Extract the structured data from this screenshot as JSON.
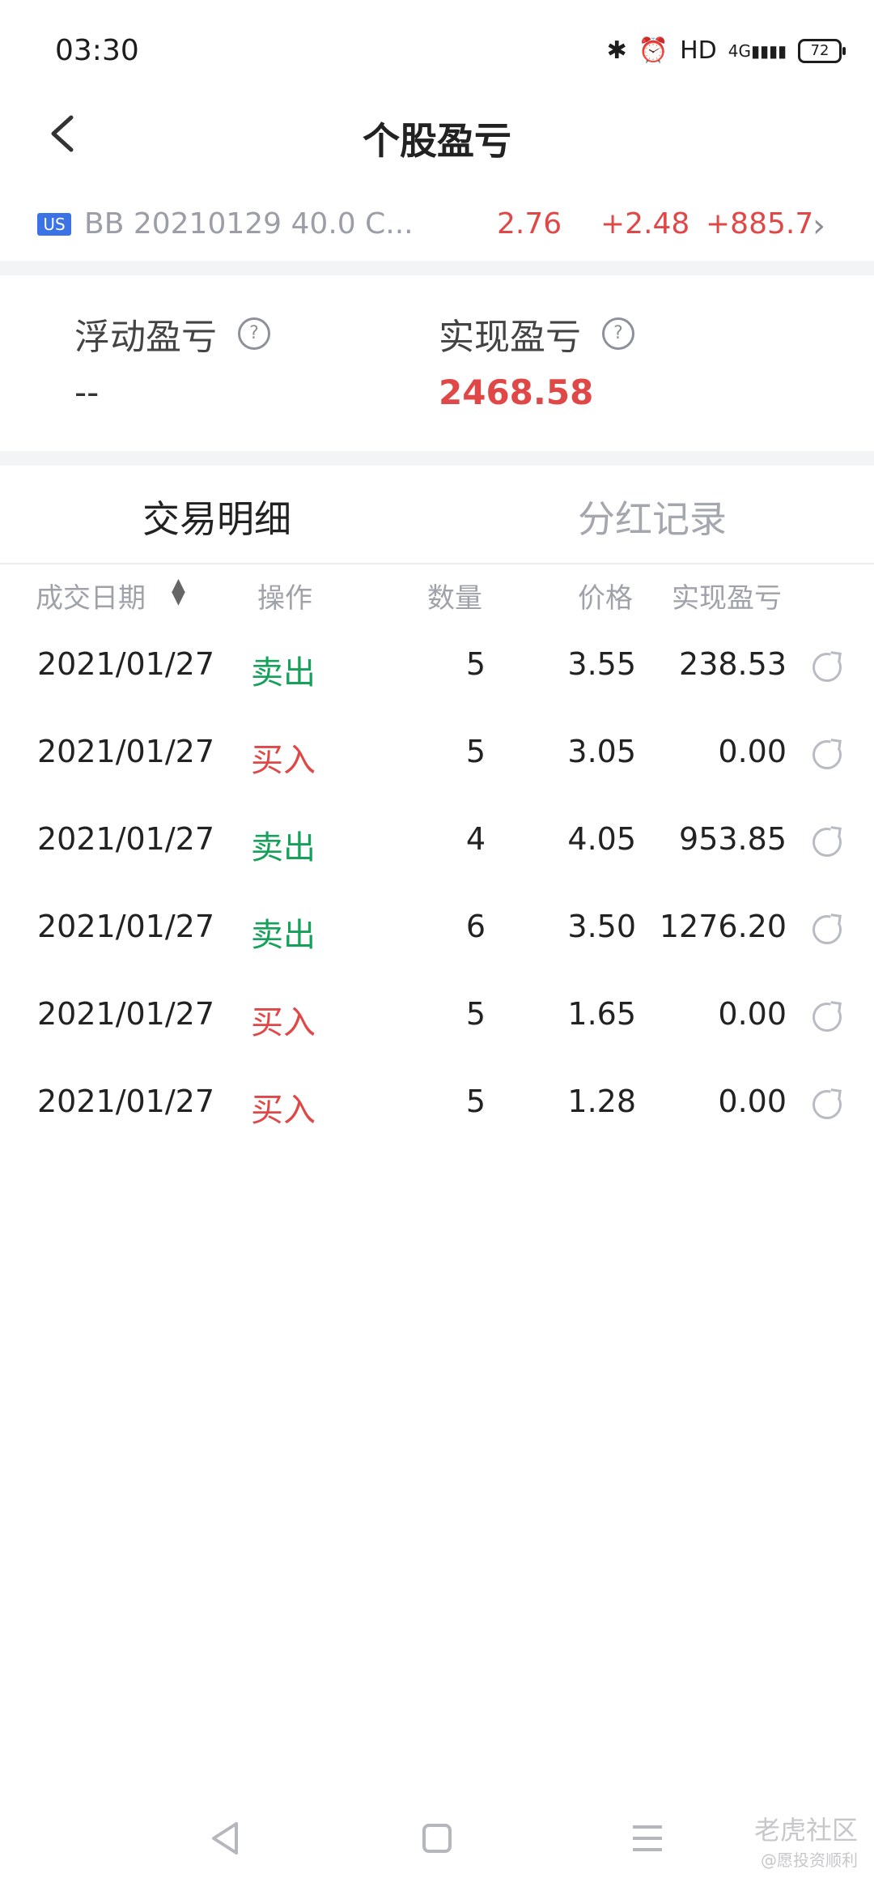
{
  "status_bar": {
    "time": "03:30",
    "icons": [
      "bluetooth-icon",
      "alarm-icon",
      "hd-icon",
      "signal-4g-icon"
    ],
    "hd_label": "HD",
    "network_label": "4G",
    "battery": "72"
  },
  "header": {
    "title": "个股盈亏",
    "back_icon": "chevron-left-icon"
  },
  "stock": {
    "badge": "US",
    "name": "BB 20210129 40.0 C...",
    "price": "2.76",
    "change": "+2.48",
    "change_pct": "+885.7",
    "chevron": "›"
  },
  "pnl": {
    "floating_label": "浮动盈亏",
    "floating_value": "--",
    "realized_label": "实现盈亏",
    "realized_value": "2468.58",
    "help": "?"
  },
  "tabs": {
    "trade_details": "交易明细",
    "dividends": "分红记录"
  },
  "table": {
    "headers": {
      "date": "成交日期",
      "action": "操作",
      "qty": "数量",
      "price": "价格",
      "realized": "实现盈亏"
    },
    "rows": [
      {
        "date": "2021/01/27",
        "action": "卖出",
        "type": "sell",
        "qty": "5",
        "price": "3.55",
        "realized": "238.53"
      },
      {
        "date": "2021/01/27",
        "action": "买入",
        "type": "buy",
        "qty": "5",
        "price": "3.05",
        "realized": "0.00"
      },
      {
        "date": "2021/01/27",
        "action": "卖出",
        "type": "sell",
        "qty": "4",
        "price": "4.05",
        "realized": "953.85"
      },
      {
        "date": "2021/01/27",
        "action": "卖出",
        "type": "sell",
        "qty": "6",
        "price": "3.50",
        "realized": "1276.20"
      },
      {
        "date": "2021/01/27",
        "action": "买入",
        "type": "buy",
        "qty": "5",
        "price": "1.65",
        "realized": "0.00"
      },
      {
        "date": "2021/01/27",
        "action": "买入",
        "type": "buy",
        "qty": "5",
        "price": "1.28",
        "realized": "0.00"
      }
    ]
  },
  "watermark": {
    "title": "老虎社区",
    "subtitle": "@愿投资顺利"
  },
  "colors": {
    "up": "#e04848",
    "down": "#15a15a",
    "badge": "#3b73e6"
  }
}
